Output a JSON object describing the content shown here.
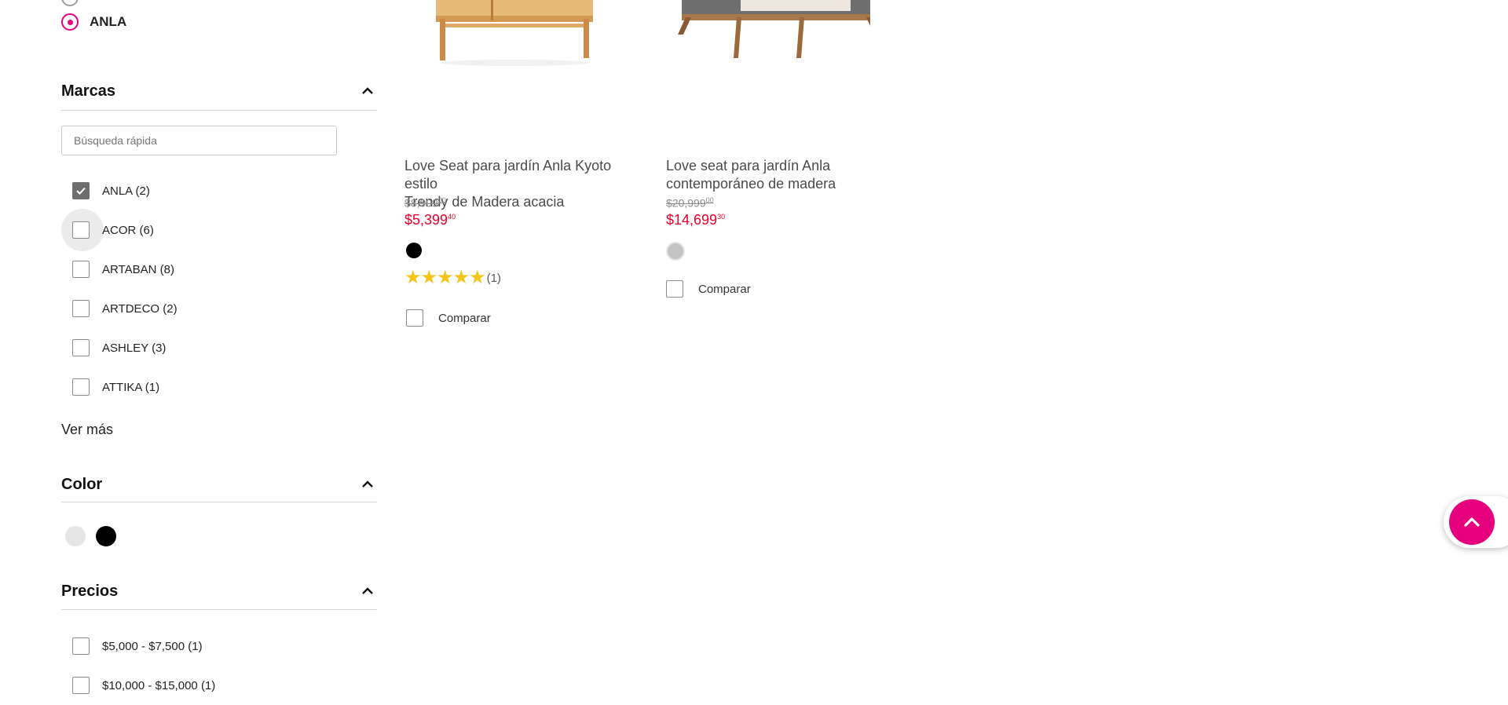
{
  "store_filter": {
    "selected_option": "ANLA"
  },
  "brands": {
    "title": "Marcas",
    "search_placeholder": "Búsqueda rápida",
    "items": [
      {
        "label": "ANLA (2)",
        "checked": true
      },
      {
        "label": "ACOR (6)",
        "checked": false
      },
      {
        "label": "ARTABAN (8)",
        "checked": false
      },
      {
        "label": "ARTDECO (2)",
        "checked": false
      },
      {
        "label": "ASHLEY (3)",
        "checked": false
      },
      {
        "label": "ATTIKA (1)",
        "checked": false
      }
    ],
    "see_more": "Ver más"
  },
  "color_filter": {
    "title": "Color",
    "swatches": [
      "#e6e6e6",
      "#000000"
    ]
  },
  "price_filter": {
    "title": "Precios",
    "items": [
      {
        "label": "$5,000 - $7,500 (1)",
        "checked": false
      },
      {
        "label": "$10,000 - $15,000 (1)",
        "checked": false
      }
    ]
  },
  "products": [
    {
      "title_line1": "Love Seat para jardín Anla Kyoto estilo",
      "title_line2": "Trendy de Madera acacia",
      "old_price": "$8,999",
      "old_cents": "00",
      "price": "$5,399",
      "price_cents": "40",
      "swatch": "#000000",
      "stars": "★★★★★",
      "rating_count": "(1)",
      "compare_label": "Comparar"
    },
    {
      "title_line1": "Love seat para jardín Anla",
      "title_line2": "contemporáneo de madera",
      "old_price": "$20,999",
      "old_cents": "00",
      "price": "$14,699",
      "price_cents": "30",
      "swatch": "#c4c4c4",
      "compare_label": "Comparar"
    }
  ],
  "icons": {
    "collapse": "chevron-up-icon",
    "check": "check-icon",
    "back_to_top": "arrow-up-icon"
  },
  "colors": {
    "accent": "#e6007e",
    "sale_price": "#e4002b",
    "star": "#f5c518"
  }
}
